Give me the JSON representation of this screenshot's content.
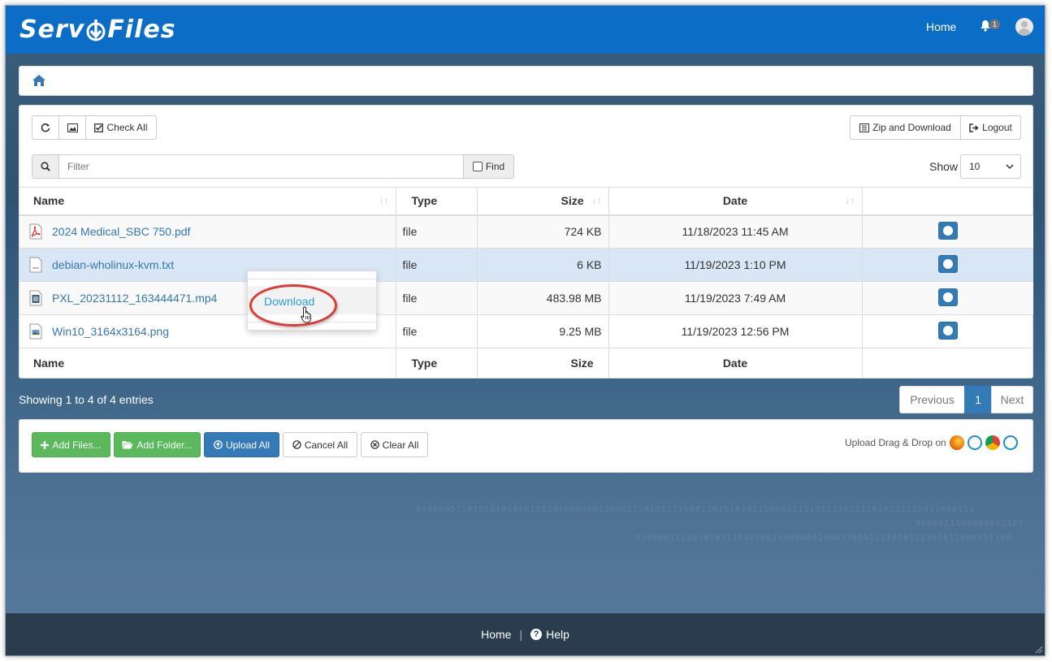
{
  "app": {
    "logo_text_left": "Serv",
    "logo_text_right": "Files",
    "nav_home": "Home",
    "notification_count": "1"
  },
  "toolbar": {
    "check_all_label": "Check All",
    "zip_download_label": "Zip and Download",
    "logout_label": "Logout"
  },
  "filter": {
    "placeholder": "Filter",
    "find_label": "Find",
    "show_label": "Show",
    "show_value": "10"
  },
  "table": {
    "headers": [
      "Name",
      "Type",
      "Size",
      "Date"
    ],
    "footers": [
      "Name",
      "Type",
      "Size",
      "Date"
    ],
    "rows": [
      {
        "name": "2024 Medical_SBC 750.pdf",
        "type": "file",
        "size": "724 KB",
        "date": "11/18/2023 11:45 AM",
        "icon": "pdf-file-icon"
      },
      {
        "name": "debian-wholinux-kvm.txt",
        "type": "file",
        "size": "6 KB",
        "date": "11/19/2023 1:10 PM",
        "icon": "text-file-icon"
      },
      {
        "name": "PXL_20231112_163444471.mp4",
        "type": "file",
        "size": "483.98 MB",
        "date": "11/19/2023 7:49 AM",
        "icon": "video-file-icon"
      },
      {
        "name": "Win10_3164x3164.png",
        "type": "file",
        "size": "9.25 MB",
        "date": "11/19/2023 12:56 PM",
        "icon": "image-file-icon"
      }
    ]
  },
  "context_menu": {
    "download_label": "Download"
  },
  "pagination": {
    "info": "Showing 1 to 4 of 4 entries",
    "previous": "Previous",
    "current": "1",
    "next": "Next"
  },
  "upload": {
    "add_files": "Add Files...",
    "add_folder": "Add Folder...",
    "upload_all": "Upload All",
    "cancel_all": "Cancel All",
    "clear_all": "Clear All",
    "drag_drop": "Upload Drag & Drop on"
  },
  "footer": {
    "home": "Home",
    "separator": "|",
    "help": "Help"
  },
  "colors": {
    "navbar": "#0c6dc6",
    "primary": "#337ab7",
    "success": "#5cb85c",
    "selected_row": "#d9e6f6",
    "highlight_ring": "#dd3a3a",
    "footer": "#2b3c4e"
  }
}
